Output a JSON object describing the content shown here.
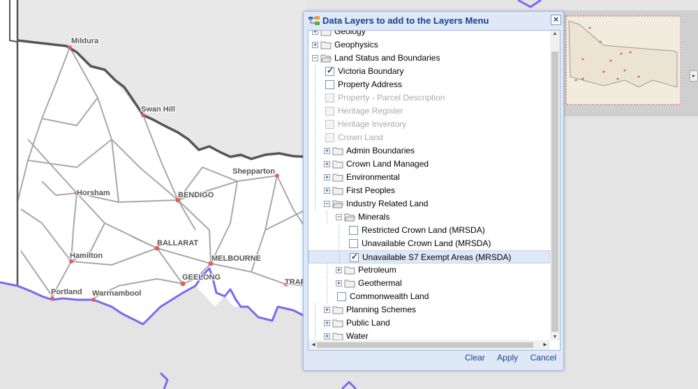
{
  "dialog": {
    "title": "Data Layers to add to the Layers Menu",
    "close_label": "×",
    "buttons": {
      "clear": "Clear",
      "apply": "Apply",
      "cancel": "Cancel"
    },
    "scroll_up": "▲",
    "scroll_down": "▼",
    "scroll_left": "◂",
    "scroll_right": "▸"
  },
  "tree": [
    {
      "label": "Geology",
      "level": 0,
      "type": "folder",
      "expanded": false
    },
    {
      "label": "Geophysics",
      "level": 0,
      "type": "folder",
      "expanded": false
    },
    {
      "label": "Land Status and Boundaries",
      "level": 0,
      "type": "folder",
      "expanded": true
    },
    {
      "label": "Victoria Boundary",
      "level": 1,
      "type": "check",
      "checked": true,
      "disabled": false
    },
    {
      "label": "Property Address",
      "level": 1,
      "type": "check",
      "checked": false,
      "disabled": false
    },
    {
      "label": "Property - Parcel Description",
      "level": 1,
      "type": "check",
      "checked": false,
      "disabled": true
    },
    {
      "label": "Heritage Register",
      "level": 1,
      "type": "check",
      "checked": false,
      "disabled": true
    },
    {
      "label": "Heritage Inventory",
      "level": 1,
      "type": "check",
      "checked": false,
      "disabled": true
    },
    {
      "label": "Crown Land",
      "level": 1,
      "type": "check",
      "checked": false,
      "disabled": true
    },
    {
      "label": "Admin Boundaries",
      "level": 1,
      "type": "folder",
      "expanded": false
    },
    {
      "label": "Crown Land Managed",
      "level": 1,
      "type": "folder",
      "expanded": false
    },
    {
      "label": "Environmental",
      "level": 1,
      "type": "folder",
      "expanded": false
    },
    {
      "label": "First Peoples",
      "level": 1,
      "type": "folder",
      "expanded": false
    },
    {
      "label": "Industry Related Land",
      "level": 1,
      "type": "folder",
      "expanded": true
    },
    {
      "label": "Minerals",
      "level": 2,
      "type": "folder",
      "expanded": true
    },
    {
      "label": "Restricted Crown Land (MRSDA)",
      "level": 3,
      "type": "check",
      "checked": false,
      "disabled": false
    },
    {
      "label": "Unavailable Crown Land (MRSDA)",
      "level": 3,
      "type": "check",
      "checked": false,
      "disabled": false
    },
    {
      "label": "Unavailable S7 Exempt Areas (MRSDA)",
      "level": 3,
      "type": "check",
      "checked": true,
      "disabled": false,
      "selected": true
    },
    {
      "label": "Petroleum",
      "level": 2,
      "type": "folder",
      "expanded": false
    },
    {
      "label": "Geothermal",
      "level": 2,
      "type": "folder",
      "expanded": false
    },
    {
      "label": "Commonwealth Land",
      "level": 2,
      "type": "check",
      "checked": false,
      "disabled": false
    },
    {
      "label": "Planning Schemes",
      "level": 1,
      "type": "folder",
      "expanded": false
    },
    {
      "label": "Public Land",
      "level": 1,
      "type": "folder",
      "expanded": false
    },
    {
      "label": "Water",
      "level": 1,
      "type": "folder",
      "expanded": false
    }
  ],
  "map": {
    "towns": {
      "mildura": "Mildura",
      "swan_hill": "Swan Hill",
      "shepparton": "Shepparton",
      "horsham": "Horsham",
      "bendigo": "BENDIGO",
      "ballarat": "BALLARAT",
      "melbourne": "MELBOURNE",
      "hamilton": "Hamilton",
      "geelong": "GEELONG",
      "portland": "Portland",
      "warrnambool": "Warrnambool",
      "traralgon": "TRAF"
    },
    "colors": {
      "state_border": "#555555",
      "coastline": "#7b68ee",
      "roads": "#a8a8a8",
      "town_dot": "#e06060"
    }
  },
  "overview": {
    "toggle": "▸"
  }
}
